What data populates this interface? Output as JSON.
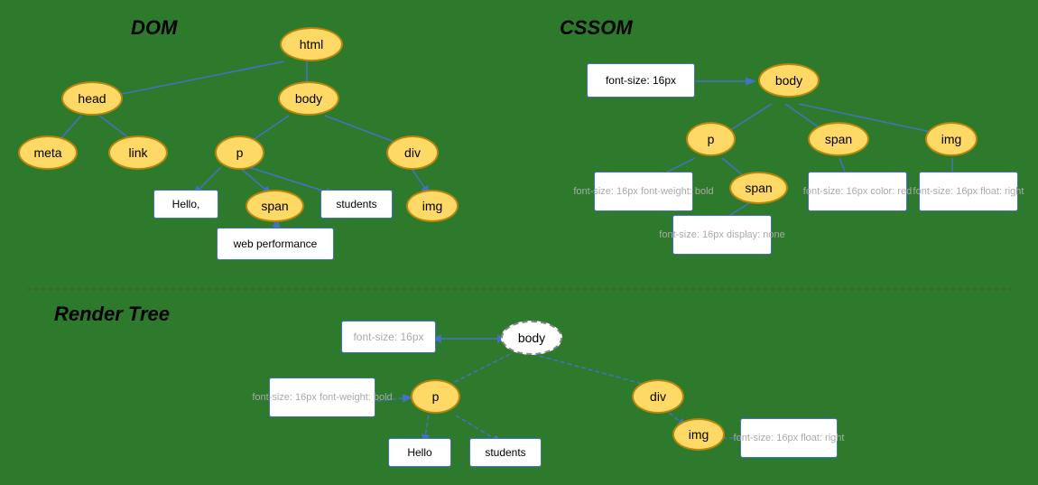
{
  "dom": {
    "title": "DOM",
    "nodes": {
      "html": "html",
      "head": "head",
      "body": "body",
      "meta": "meta",
      "link": "link",
      "p": "p",
      "div": "div",
      "span": "span",
      "img_dom": "img",
      "hello": "Hello,",
      "students": "students",
      "web_performance": "web performance"
    }
  },
  "cssom": {
    "title": "CSSOM",
    "nodes": {
      "body": "body",
      "p": "p",
      "span_cssom": "span",
      "img_cssom": "img",
      "span_child": "span",
      "font16_body": "font-size: 16px",
      "font16_p": "font-size: 16px\nfont-weight: bold",
      "font16_span_child": "font-size: 16px\ndisplay: none",
      "font16_span": "font-size: 16px\ncolor: red",
      "font16_img": "font-size: 16px\nfloat: right"
    }
  },
  "render_tree": {
    "title": "Render Tree",
    "nodes": {
      "body": "body",
      "p": "p",
      "div": "div",
      "img": "img",
      "hello": "Hello",
      "students": "students",
      "font16_body": "font-size: 16px",
      "font16_p": "font-size: 16px\nfont-weight: bold",
      "font16_img": "font-size: 16px\nfloat: right"
    }
  }
}
